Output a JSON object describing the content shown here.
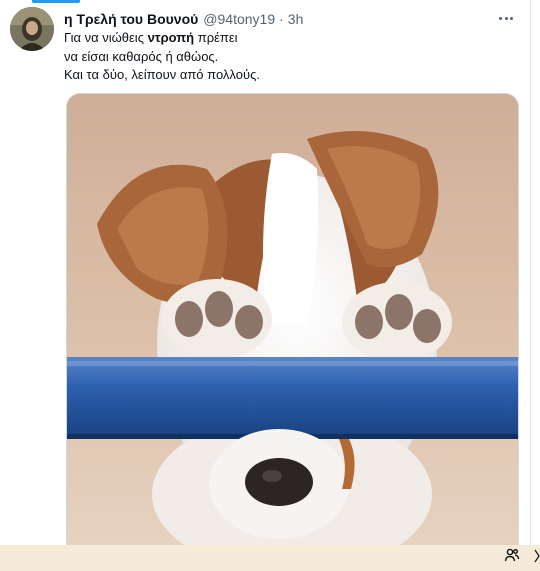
{
  "tweet": {
    "display_name": "η Τρελή του Βουνού",
    "handle": "@94tony19",
    "separator": "·",
    "time": "3h",
    "text": {
      "line1_before": "Για να νιώθεις ",
      "line1_bold": "ντροπή",
      "line1_after": " πρέπει",
      "line2": "να είσαι καθαρός ή αθώος.",
      "line3": "Και τα δύο, λείπουν από πολλούς."
    }
  },
  "icons": {
    "more": "more-horizontal-icon",
    "people": "people-icon"
  },
  "colors": {
    "accent": "#1d9bf0",
    "text_primary": "#0f1419",
    "text_secondary": "#536471",
    "bottom_bar": "#f6ead9"
  }
}
